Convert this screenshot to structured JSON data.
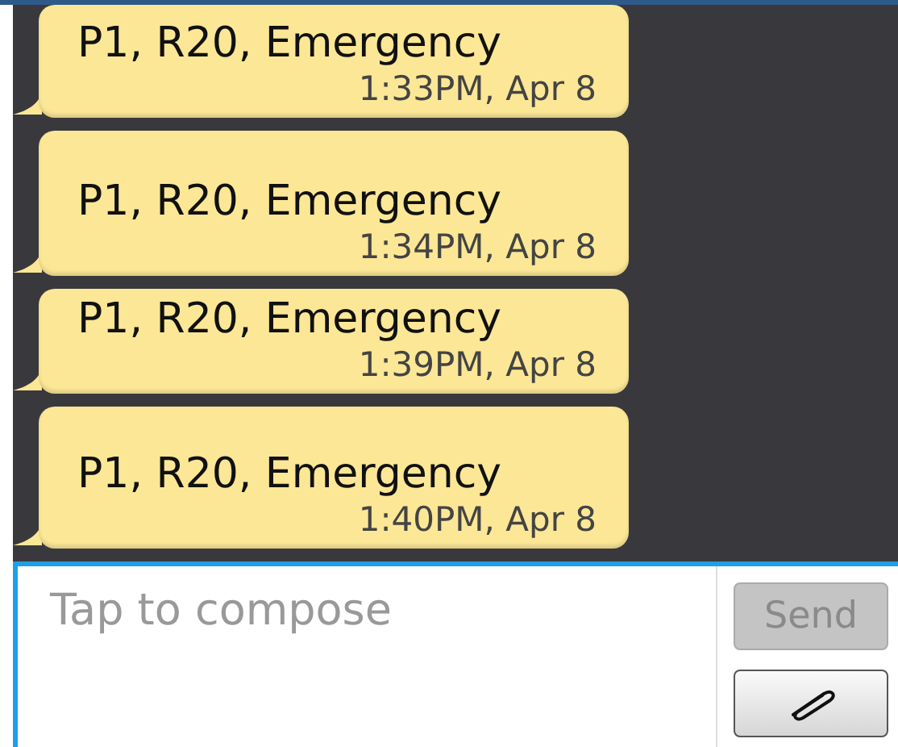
{
  "messages": [
    {
      "text": "P1, R20, Emergency",
      "time": "1:33PM, Apr 8"
    },
    {
      "text": "P1, R20, Emergency",
      "time": "1:34PM, Apr 8"
    },
    {
      "text": "P1, R20, Emergency",
      "time": "1:39PM, Apr 8"
    },
    {
      "text": "P1, R20, Emergency",
      "time": "1:40PM, Apr 8"
    }
  ],
  "compose": {
    "placeholder": "Tap to compose"
  },
  "send_button": {
    "label": "Send",
    "disabled": true
  }
}
